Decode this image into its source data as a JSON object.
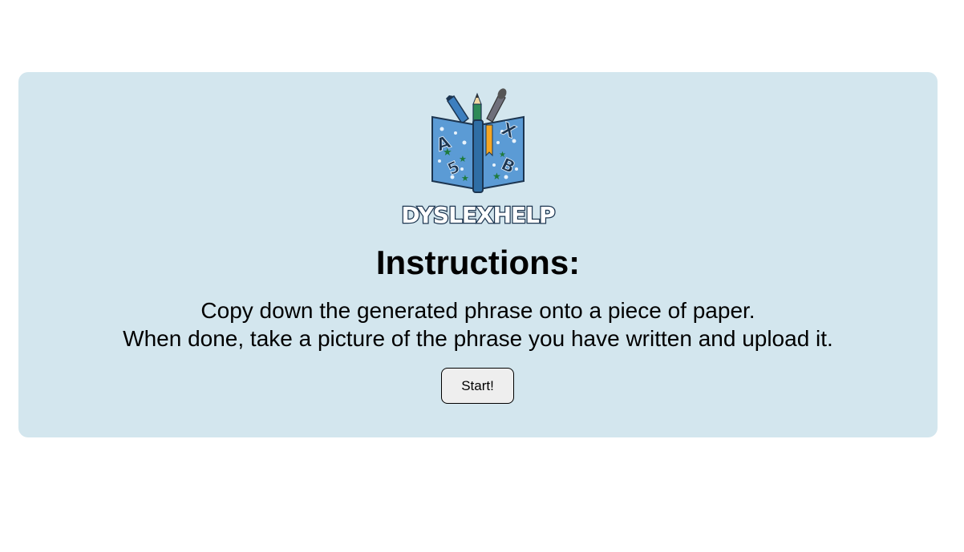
{
  "logo": {
    "text": "DYSLEXHELP",
    "book_letters": [
      "A",
      "5",
      "X",
      "B"
    ]
  },
  "instructions": {
    "title": "Instructions:",
    "line1": "Copy down the generated phrase onto a piece of paper.",
    "line2": "When done, take a picture of the phrase you have written and upload it."
  },
  "start_button": {
    "label": "Start!"
  },
  "colors": {
    "card_background": "#d3e6ee",
    "logo_blue": "#3d7fbf",
    "logo_dark": "#1c3550"
  }
}
